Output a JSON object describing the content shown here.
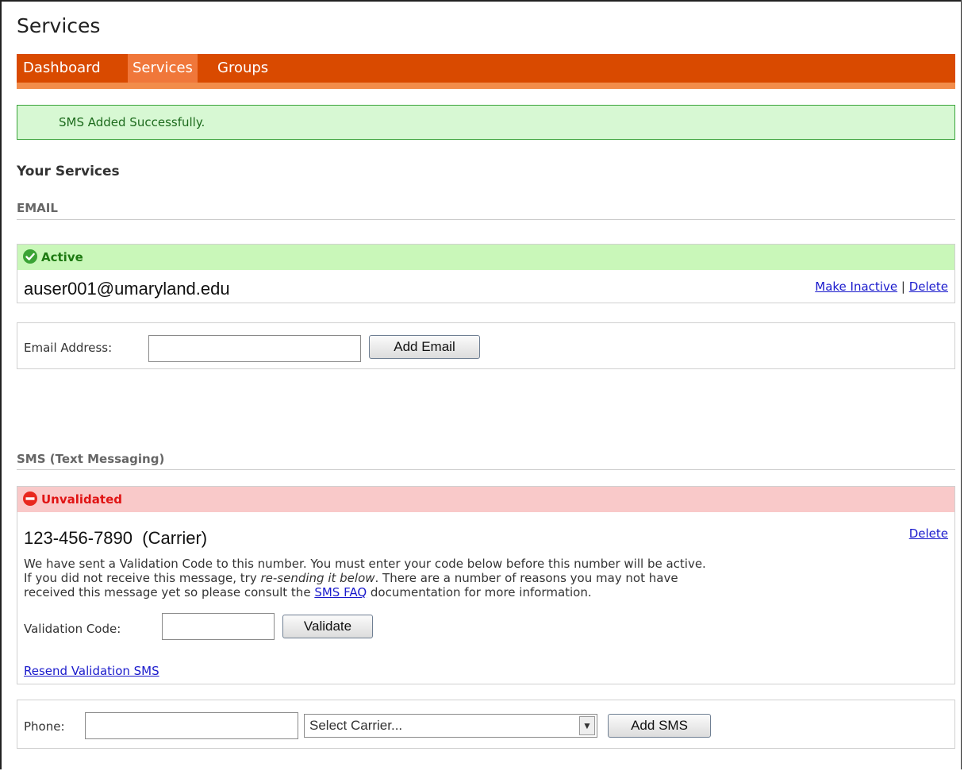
{
  "page_title": "Services",
  "nav": {
    "items": [
      {
        "label": "Dashboard"
      },
      {
        "label": "Services"
      },
      {
        "label": "Groups"
      }
    ]
  },
  "flash": {
    "message": "SMS Added Successfully."
  },
  "your_services": {
    "heading": "Your Services"
  },
  "email": {
    "heading": "EMAIL",
    "status": "Active",
    "address": "auser001@umaryland.edu",
    "make_inactive": "Make Inactive",
    "separator": "|",
    "delete": "Delete",
    "add_form": {
      "label": "Email Address:",
      "value": "",
      "button": "Add Email"
    }
  },
  "sms": {
    "heading": "SMS (Text Messaging)",
    "status": "Unvalidated",
    "number": "123-456-7890",
    "carrier": "(Carrier)",
    "delete": "Delete",
    "message_part1": "We have sent a Validation Code to this number. You must enter your code below before this number will be active.",
    "message_part2": "If you did not receive this message, try ",
    "message_resend_em": "re-sending it below",
    "message_part3": ". There are a number of reasons you may not have",
    "message_part4": "received this message yet so please consult the ",
    "message_faq_link": "SMS FAQ",
    "message_part5": " documentation for more information.",
    "validation": {
      "label": "Validation Code:",
      "value": "",
      "button": "Validate"
    },
    "resend_link": "Resend Validation SMS",
    "add_form": {
      "phone_label": "Phone:",
      "phone_value": "",
      "carrier_selected": "Select Carrier...",
      "button": "Add SMS"
    }
  },
  "colors": {
    "nav_bg": "#d94a00",
    "nav_active": "#f0773a",
    "success_bg": "#d7f8d3",
    "active_bg": "#c9f7b9",
    "unvalidated_bg": "#f9c9c9",
    "link": "#1a1acc"
  },
  "icons": {
    "active": "check-circle-icon",
    "unvalidated": "minus-circle-icon",
    "dropdown": "chevron-down-icon"
  }
}
